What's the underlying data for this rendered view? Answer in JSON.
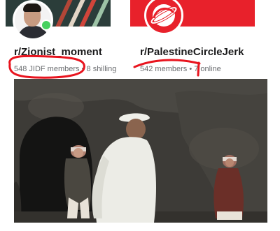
{
  "cards": [
    {
      "subreddit": "r/Zionist_moment",
      "members": "548 JIDF members",
      "separator": "•",
      "online": "8 shilling"
    },
    {
      "subreddit": "r/PalestineCircleJerk",
      "members": "542 members",
      "separator": "•",
      "online": "7 online"
    }
  ],
  "annotation_color": "#e8141e",
  "brand_red": "#e8212b",
  "icons": {
    "community_icon": "planet-icon",
    "online_indicator": "online-dot"
  }
}
